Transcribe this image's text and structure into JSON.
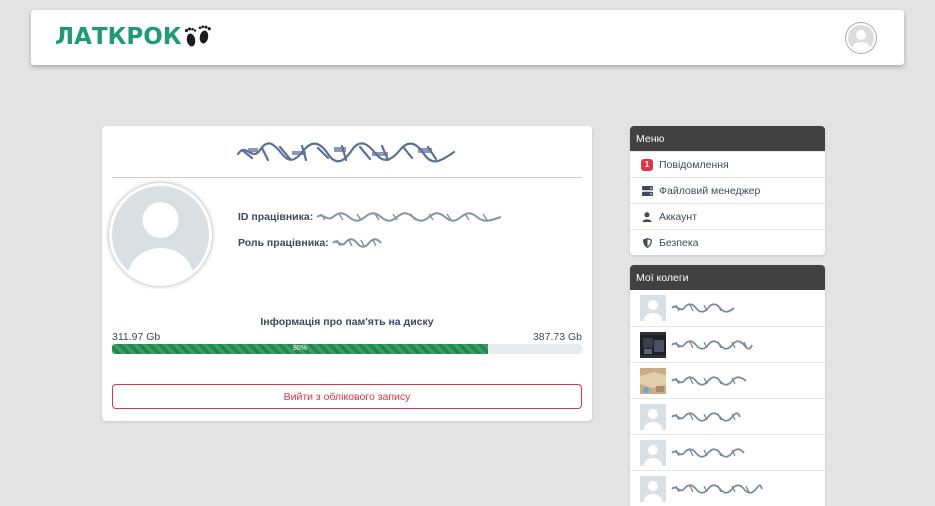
{
  "header": {
    "logo_text": "ЛАТКРОК"
  },
  "profile": {
    "id_label": "ID працівника:",
    "role_label": "Роль працівника:",
    "disk": {
      "title": "Інформація про пам'ять на диску",
      "used": "311.97 Gb",
      "total": "387.73 Gb",
      "percent_label": "80%",
      "fraction": 0.8
    },
    "logout_label": "Вийти з облікового запису"
  },
  "menu": {
    "title": "Меню",
    "items": [
      {
        "icon": "notification-badge",
        "badge": "1",
        "label": "Повідомлення"
      },
      {
        "icon": "server-icon",
        "label": "Файловий менеджер"
      },
      {
        "icon": "user-icon",
        "label": "Аккаунт"
      },
      {
        "icon": "shield-icon",
        "label": "Безпека"
      }
    ]
  },
  "colleagues": {
    "title": "Мої колеги",
    "count_visible": 6
  },
  "colors": {
    "brand_green": "#1f9b6f",
    "progress_green": "#1e8a4a",
    "danger_red": "#dc3545",
    "panel_header": "#414141",
    "background": "#e4e3e3"
  }
}
